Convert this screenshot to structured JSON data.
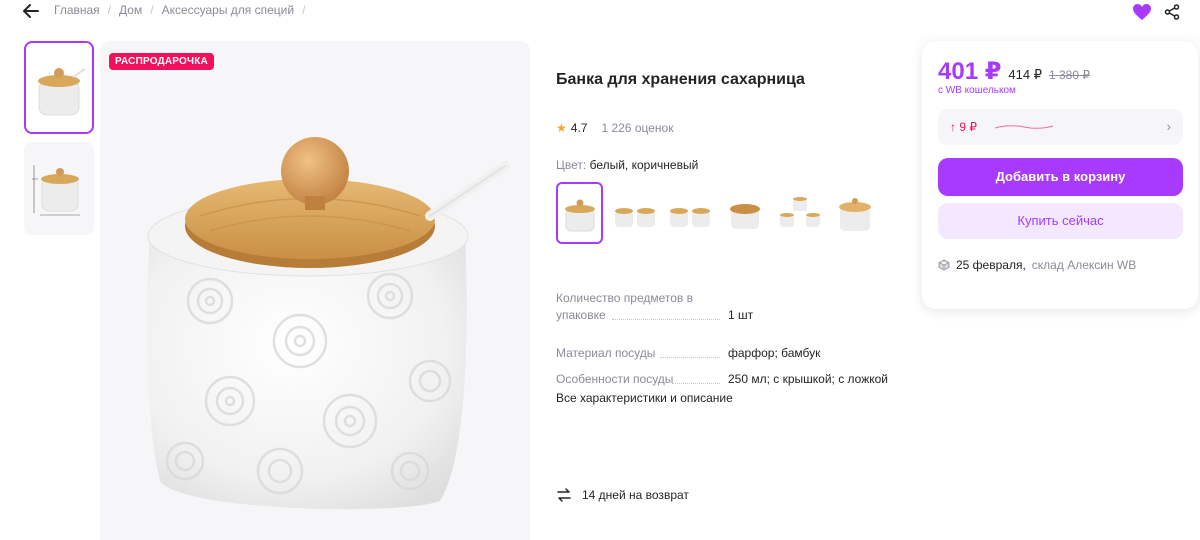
{
  "breadcrumb": {
    "items": [
      "Главная",
      "Дом",
      "Аксессуары для специй"
    ],
    "sep": "/"
  },
  "badge": "РАСПРОДАРОЧКА",
  "product": {
    "title": "Банка для хранения сахарница",
    "rating": "4.7",
    "reviews": "1 226 оценок",
    "color_label": "Цвет:",
    "color_value": "белый, коричневый"
  },
  "specs": [
    {
      "key_line1": "Количество предметов в",
      "key_line2": "упаковке",
      "value": "1 шт"
    },
    {
      "key": "Материал посуды",
      "value": "фарфор; бамбук"
    },
    {
      "key": "Особенности посуды",
      "value": "250 мл; с крышкой; с ложкой"
    }
  ],
  "all_specs_link": "Все характеристики и описание",
  "returns": "14 дней на возврат",
  "price": {
    "main": "401 ₽",
    "second": "414 ₽",
    "old": "1 380 ₽",
    "wallet_note": "с WB кошельком",
    "cashback": "9 ₽"
  },
  "buttons": {
    "cart": "Добавить в корзину",
    "buy": "Купить сейчас"
  },
  "delivery": {
    "date": "25 февраля,",
    "warehouse": "склад Алексин WB"
  },
  "colors": {
    "accent": "#a73afd",
    "sale": "#f2105a",
    "muted": "#8b8b99",
    "bamboo": "#d8a85a"
  },
  "icons": [
    "arrow-left-icon",
    "heart-icon",
    "share-icon",
    "star-icon",
    "chevron-right-icon",
    "return-icon",
    "box-icon",
    "arrow-up-icon"
  ]
}
